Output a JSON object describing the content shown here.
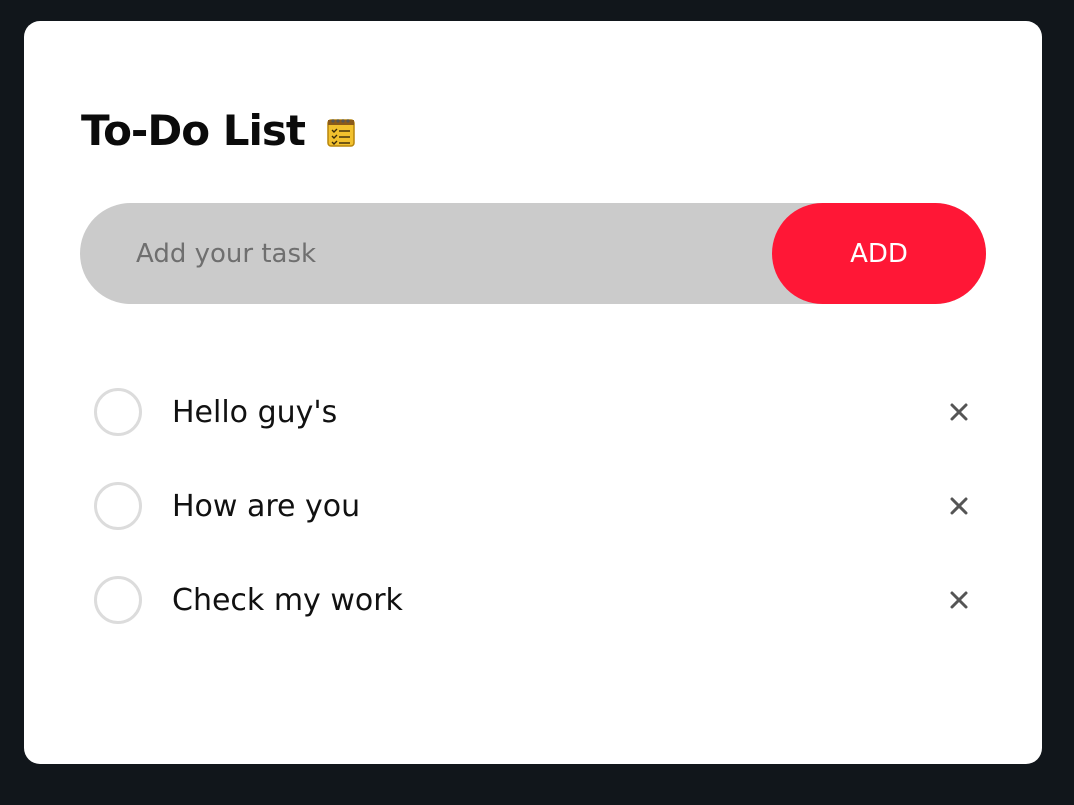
{
  "header": {
    "title": "To-Do List",
    "title_icon": "notepad-icon"
  },
  "input": {
    "placeholder": "Add your task",
    "value": ""
  },
  "add_button": {
    "label": "ADD",
    "color": "#ff1736"
  },
  "tasks": [
    {
      "text": "Hello guy's",
      "checked": false,
      "delete_icon": "close-icon"
    },
    {
      "text": "How are you",
      "checked": false,
      "delete_icon": "close-icon"
    },
    {
      "text": "Check my work",
      "checked": false,
      "delete_icon": "close-icon"
    }
  ],
  "colors": {
    "background": "#11161b",
    "card": "#ffffff",
    "input_bar": "#cbcbcb",
    "accent": "#ff1736"
  }
}
